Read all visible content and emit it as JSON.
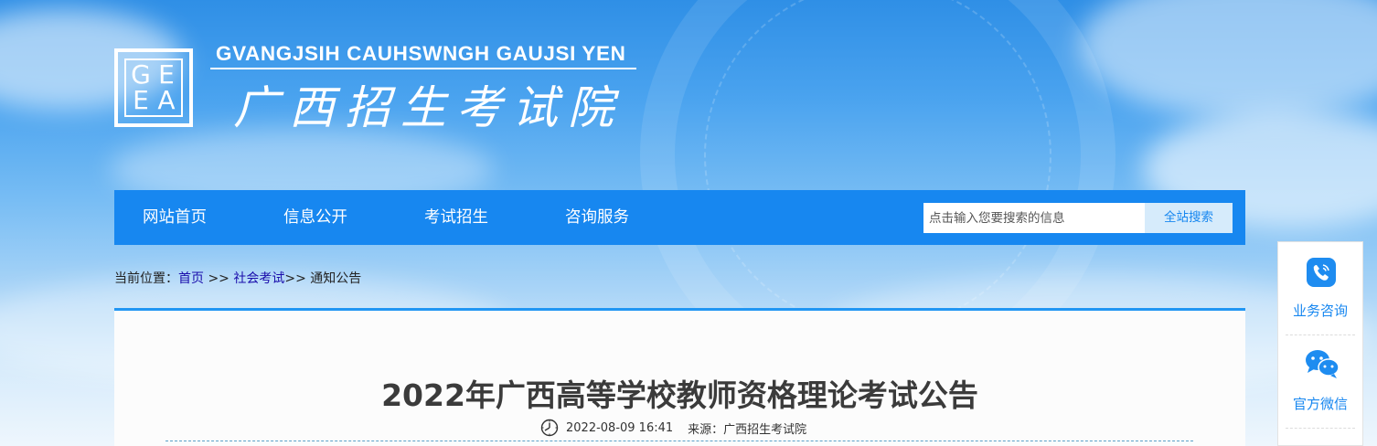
{
  "header": {
    "logo_letters": [
      "G",
      "E",
      "E",
      "A"
    ],
    "institution_en": "GVANGJSIH CAUHSWNGH GAUJSI YEN",
    "institution_zh": "广西招生考试院"
  },
  "nav": {
    "items": [
      {
        "label": "网站首页"
      },
      {
        "label": "信息公开"
      },
      {
        "label": "考试招生"
      },
      {
        "label": "咨询服务"
      }
    ],
    "search_placeholder": "点击输入您要搜索的信息",
    "search_button": "全站搜索"
  },
  "breadcrumb": {
    "prefix": "当前位置：",
    "home": "首页",
    "sep1": " >> ",
    "section": "社会考试",
    "sep2": ">> ",
    "current": "通知公告"
  },
  "article": {
    "title": "2022年广西高等学校教师资格理论考试公告",
    "datetime": "2022-08-09 16:41",
    "source": "来源：广西招生考试院"
  },
  "side_panel": {
    "items": [
      {
        "label": "业务咨询",
        "icon": "phone-icon"
      },
      {
        "label": "官方微信",
        "icon": "wechat-icon"
      }
    ]
  },
  "colors": {
    "nav_blue": "#1787f0",
    "content_border": "#2196f3",
    "title_text": "#3b3b3b",
    "link_blue": "#1a0dab"
  }
}
